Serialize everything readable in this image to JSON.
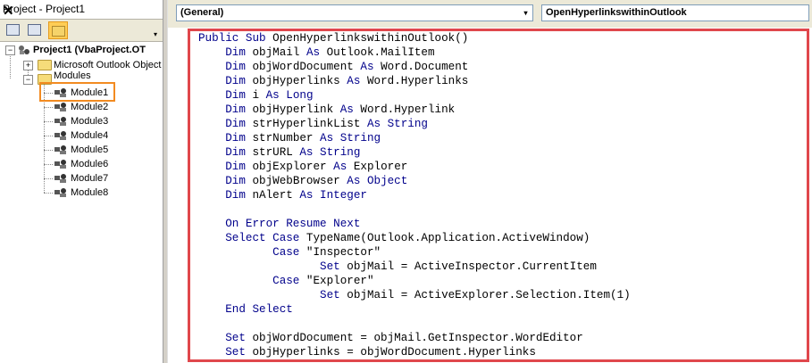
{
  "project_pane": {
    "title": "Project - Project1",
    "close": "✕",
    "scroll_arrow": "▾",
    "root": {
      "label": "Project1 (VbaProject.OT",
      "expander": "−"
    },
    "folders": [
      {
        "label": "Microsoft Outlook Object",
        "expander": "+"
      },
      {
        "label": "Modules",
        "expander": "−"
      }
    ],
    "modules": [
      "Module1",
      "Module2",
      "Module3",
      "Module4",
      "Module5",
      "Module6",
      "Module7",
      "Module8"
    ],
    "selected_module": "Module1",
    "highlight_color": "#f28b21"
  },
  "code_pane": {
    "object_combo": "(General)",
    "procedure_combo": "OpenHyperlinkswithinOutlook",
    "combo_arrow": "▾",
    "frame_color": "#e0474c",
    "keyword_color": "#00008b",
    "lines": [
      [
        {
          "t": "Public Sub ",
          "k": 1
        },
        {
          "t": "OpenHyperlinkswithinOutlook()",
          "k": 0
        }
      ],
      [
        {
          "t": "    Dim ",
          "k": 1
        },
        {
          "t": "objMail ",
          "k": 0
        },
        {
          "t": "As ",
          "k": 1
        },
        {
          "t": "Outlook.MailItem",
          "k": 0
        }
      ],
      [
        {
          "t": "    Dim ",
          "k": 1
        },
        {
          "t": "objWordDocument ",
          "k": 0
        },
        {
          "t": "As ",
          "k": 1
        },
        {
          "t": "Word.Document",
          "k": 0
        }
      ],
      [
        {
          "t": "    Dim ",
          "k": 1
        },
        {
          "t": "objHyperlinks ",
          "k": 0
        },
        {
          "t": "As ",
          "k": 1
        },
        {
          "t": "Word.Hyperlinks",
          "k": 0
        }
      ],
      [
        {
          "t": "    Dim ",
          "k": 1
        },
        {
          "t": "i ",
          "k": 0
        },
        {
          "t": "As Long",
          "k": 1
        }
      ],
      [
        {
          "t": "    Dim ",
          "k": 1
        },
        {
          "t": "objHyperlink ",
          "k": 0
        },
        {
          "t": "As ",
          "k": 1
        },
        {
          "t": "Word.Hyperlink",
          "k": 0
        }
      ],
      [
        {
          "t": "    Dim ",
          "k": 1
        },
        {
          "t": "strHyperlinkList ",
          "k": 0
        },
        {
          "t": "As String",
          "k": 1
        }
      ],
      [
        {
          "t": "    Dim ",
          "k": 1
        },
        {
          "t": "strNumber ",
          "k": 0
        },
        {
          "t": "As String",
          "k": 1
        }
      ],
      [
        {
          "t": "    Dim ",
          "k": 1
        },
        {
          "t": "strURL ",
          "k": 0
        },
        {
          "t": "As String",
          "k": 1
        }
      ],
      [
        {
          "t": "    Dim ",
          "k": 1
        },
        {
          "t": "objExplorer ",
          "k": 0
        },
        {
          "t": "As ",
          "k": 1
        },
        {
          "t": "Explorer",
          "k": 0
        }
      ],
      [
        {
          "t": "    Dim ",
          "k": 1
        },
        {
          "t": "objWebBrowser ",
          "k": 0
        },
        {
          "t": "As Object",
          "k": 1
        }
      ],
      [
        {
          "t": "    Dim ",
          "k": 1
        },
        {
          "t": "nAlert ",
          "k": 0
        },
        {
          "t": "As Integer",
          "k": 1
        }
      ],
      [],
      [
        {
          "t": "    On Error Resume Next",
          "k": 1
        }
      ],
      [
        {
          "t": "    Select Case ",
          "k": 1
        },
        {
          "t": "TypeName(Outlook.Application.ActiveWindow)",
          "k": 0
        }
      ],
      [
        {
          "t": "           Case ",
          "k": 1
        },
        {
          "t": "\"Inspector\"",
          "k": 0
        }
      ],
      [
        {
          "t": "                  Set ",
          "k": 1
        },
        {
          "t": "objMail = ActiveInspector.CurrentItem",
          "k": 0
        }
      ],
      [
        {
          "t": "           Case ",
          "k": 1
        },
        {
          "t": "\"Explorer\"",
          "k": 0
        }
      ],
      [
        {
          "t": "                  Set ",
          "k": 1
        },
        {
          "t": "objMail = ActiveExplorer.Selection.Item(1)",
          "k": 0
        }
      ],
      [
        {
          "t": "    End Select",
          "k": 1
        }
      ],
      [],
      [
        {
          "t": "    Set ",
          "k": 1
        },
        {
          "t": "objWordDocument = objMail.GetInspector.WordEditor",
          "k": 0
        }
      ],
      [
        {
          "t": "    Set ",
          "k": 1
        },
        {
          "t": "objHyperlinks = objWordDocument.Hyperlinks",
          "k": 0
        }
      ]
    ]
  }
}
